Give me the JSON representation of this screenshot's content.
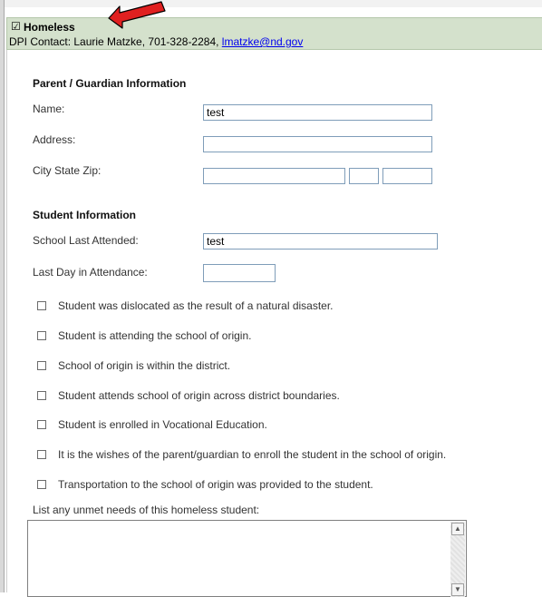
{
  "header": {
    "check_mark": "☑",
    "title": "Homeless",
    "contact_prefix": "DPI Contact: Laurie Matzke, 701-328-2284, ",
    "contact_email": "lmatzke@nd.gov",
    "bg_color": "#d4e1cc"
  },
  "parent": {
    "heading": "Parent / Guardian Information",
    "name_label": "Name:",
    "name_value": "test",
    "address_label": "Address:",
    "address_value": "",
    "city_label": "City State Zip:",
    "city_value": "",
    "state_value": "",
    "zip_value": ""
  },
  "student": {
    "heading": "Student Information",
    "school_label": "School Last Attended:",
    "school_value": "test",
    "lastday_label": "Last Day in Attendance:",
    "lastday_value": ""
  },
  "checkboxes": [
    {
      "label": "Student was dislocated as the result of a natural disaster.",
      "checked": false
    },
    {
      "label": "Student is attending the school of origin.",
      "checked": false
    },
    {
      "label": "School of origin is within the district.",
      "checked": false
    },
    {
      "label": "Student attends school of origin across district boundaries.",
      "checked": false
    },
    {
      "label": "Student is enrolled in Vocational Education.",
      "checked": false
    },
    {
      "label": "It is the wishes of the parent/guardian to enroll the student in the school of origin.",
      "checked": false
    },
    {
      "label": "Transportation to the school of origin was provided to the student.",
      "checked": false
    }
  ],
  "needs": {
    "label": "List any unmet needs of this homeless student:",
    "value": ""
  },
  "icons": {
    "arrow": "red-arrow-icon",
    "scroll_up": "▲",
    "scroll_down": "▼"
  }
}
